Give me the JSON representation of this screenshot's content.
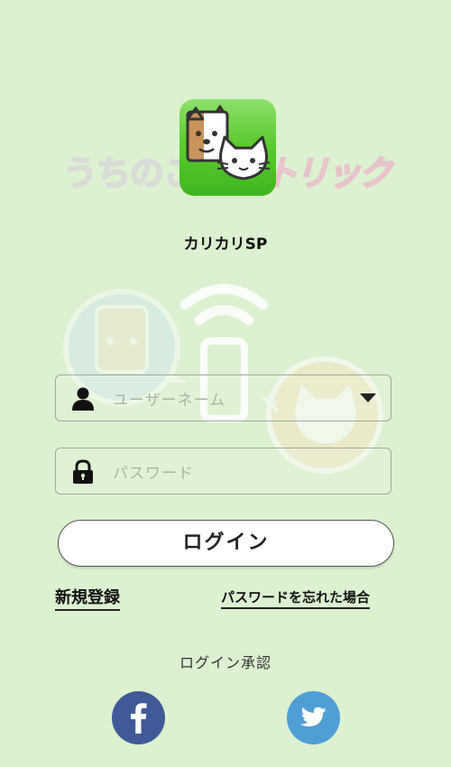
{
  "app": {
    "logo_text": "うちのこ",
    "logo_text_right": "トリック",
    "title": "カリカリSP"
  },
  "form": {
    "username_placeholder": "ユーザーネーム",
    "password_placeholder": "パスワード",
    "login_label": "ログイン"
  },
  "links": {
    "register": "新規登録",
    "forgot_password": "パスワードを忘れた場合"
  },
  "social": {
    "heading": "ログイン承認",
    "facebook_icon": "facebook-icon",
    "twitter_icon": "twitter-icon"
  },
  "colors": {
    "background": "#dcf1cf",
    "facebook": "#3e5b98",
    "twitter": "#4f9ed6",
    "app_icon_green": "#5ccb2f"
  }
}
